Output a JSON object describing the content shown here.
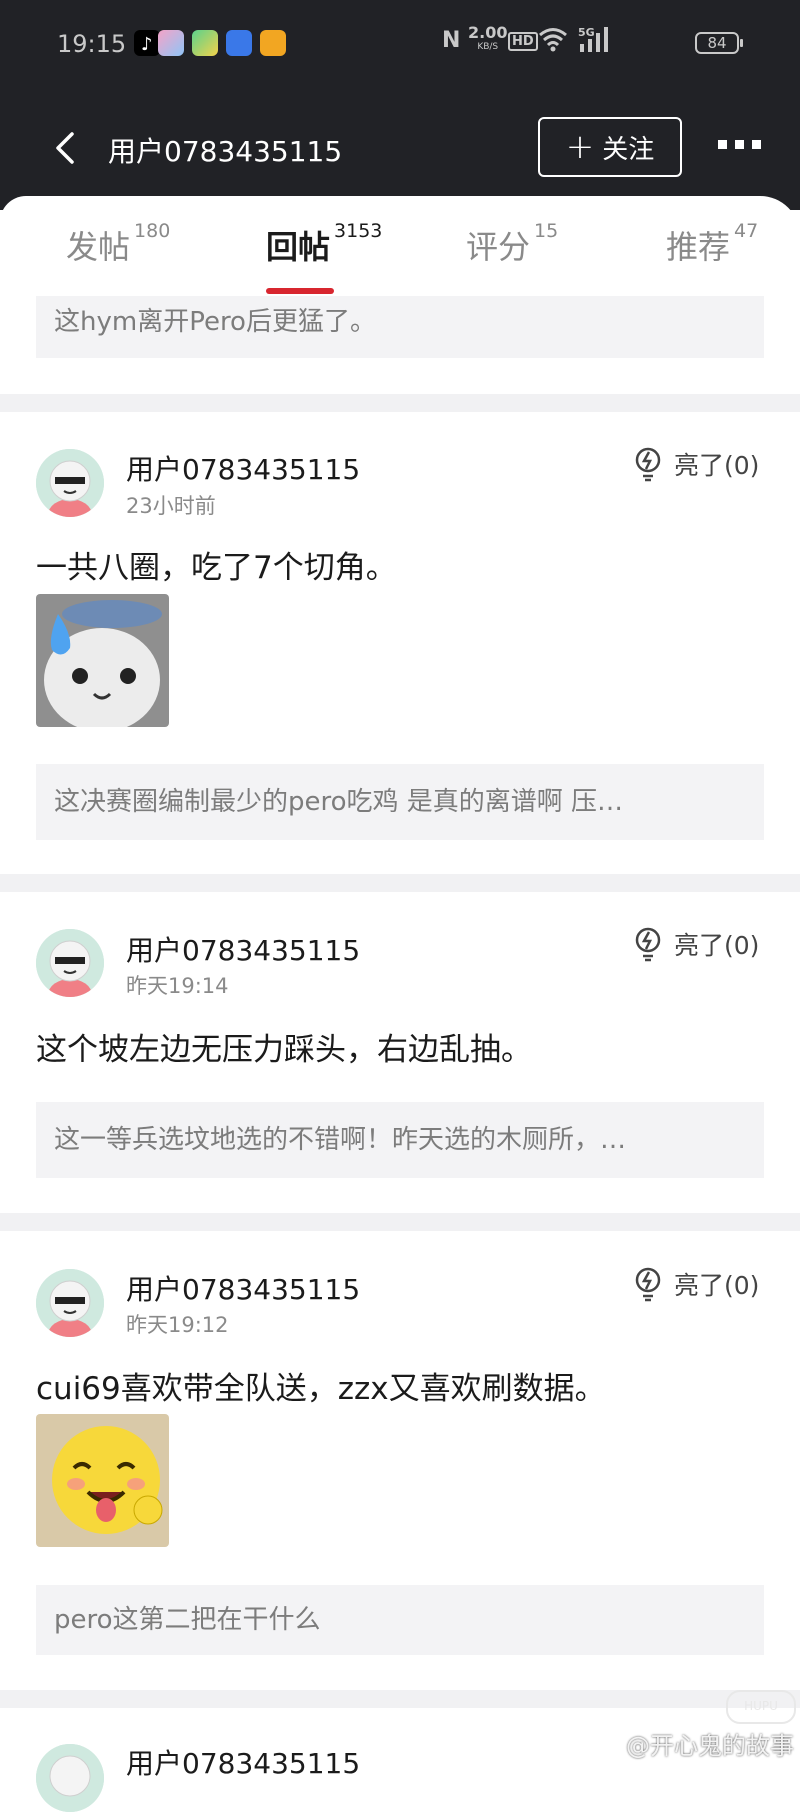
{
  "status_bar": {
    "time": "19:15",
    "app_icons": [
      "tiktok-icon",
      "gallery-icon",
      "wallet-icon",
      "cloud-icon",
      "weibo-icon"
    ],
    "nfc": "N",
    "net_speed": "2.00",
    "net_unit": "KB/S",
    "hd": "HD",
    "signal": "5G",
    "battery": "84"
  },
  "header": {
    "title": "用户0783435115",
    "follow_label": "关注"
  },
  "tabs": [
    {
      "label": "发帖",
      "count": "180"
    },
    {
      "label": "回帖",
      "count": "3153"
    },
    {
      "label": "评分",
      "count": "15"
    },
    {
      "label": "推荐",
      "count": "47"
    }
  ],
  "top_quote": "这hym离开Pero后更猛了。",
  "posts": [
    {
      "username": "用户0783435115",
      "time": "23小时前",
      "light_label": "亮了(0)",
      "text": "一共八圈，吃了7个切角。",
      "quote": "这决赛圈编制最少的pero吃鸡 是真的离谱啊 压…"
    },
    {
      "username": "用户0783435115",
      "time": "昨天19:14",
      "light_label": "亮了(0)",
      "text": "这个坡左边无压力踩头，右边乱抽。",
      "quote": "这一等兵选坟地选的不错啊！昨天选的木厕所，…"
    },
    {
      "username": "用户0783435115",
      "time": "昨天19:12",
      "light_label": "亮了(0)",
      "text": "cui69喜欢带全队送，zzx又喜欢刷数据。",
      "quote": "pero这第二把在干什么"
    },
    {
      "username": "用户0783435115"
    }
  ],
  "watermark": "@开心鬼的故事",
  "watermark_logo": "HUPU",
  "colors": {
    "header_bg": "#212226",
    "accent_red": "#d8262f",
    "quote_bg": "#f3f3f5",
    "divider_bg": "#f1f1f3"
  }
}
